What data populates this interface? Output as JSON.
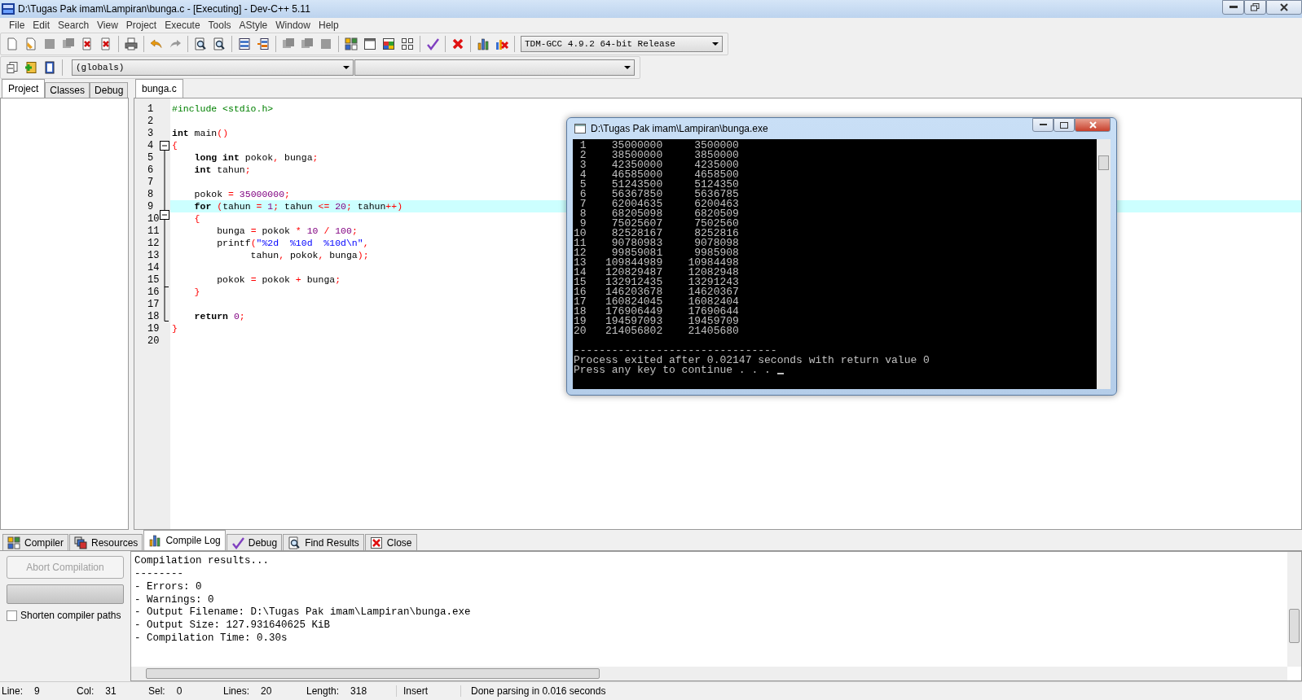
{
  "window": {
    "title": "D:\\Tugas Pak imam\\Lampiran\\bunga.c - [Executing] - Dev-C++ 5.11"
  },
  "menu": [
    "File",
    "Edit",
    "Search",
    "View",
    "Project",
    "Execute",
    "Tools",
    "AStyle",
    "Window",
    "Help"
  ],
  "toolbar": {
    "compiler": "TDM-GCC 4.9.2 64-bit Release",
    "scope": "(globals)"
  },
  "left_tabs": [
    {
      "label": "Project",
      "selected": true
    },
    {
      "label": "Classes",
      "selected": false
    },
    {
      "label": "Debug",
      "selected": false
    }
  ],
  "editor": {
    "tabs": [
      {
        "label": "bunga.c",
        "selected": true
      }
    ],
    "lines": [
      {
        "number": "1",
        "current": false,
        "tokens": [
          {
            "text": "#include <stdio.h>",
            "kind": "pp"
          }
        ]
      },
      {
        "number": "2",
        "current": false
      },
      {
        "number": "3",
        "current": false,
        "tokens": [
          {
            "text": "int",
            "kind": "kw"
          },
          {
            "text": " main",
            "kind": "id"
          },
          {
            "text": "()",
            "kind": "op"
          }
        ]
      },
      {
        "number": "4",
        "current": false,
        "tokens": [
          {
            "text": "{",
            "kind": "op"
          }
        ]
      },
      {
        "number": "5",
        "current": false,
        "tokens": [
          {
            "text": "    long int",
            "kind": "kw"
          },
          {
            "text": " pokok",
            "kind": "id"
          },
          {
            "text": ",",
            "kind": "op"
          },
          {
            "text": " bunga",
            "kind": "id"
          },
          {
            "text": ";",
            "kind": "op"
          }
        ]
      },
      {
        "number": "6",
        "current": false,
        "tokens": [
          {
            "text": "    int",
            "kind": "kw"
          },
          {
            "text": " tahun",
            "kind": "id"
          },
          {
            "text": ";",
            "kind": "op"
          }
        ]
      },
      {
        "number": "7",
        "current": false
      },
      {
        "number": "8",
        "current": false,
        "tokens": [
          {
            "text": "    pokok ",
            "kind": "id"
          },
          {
            "text": "= ",
            "kind": "op"
          },
          {
            "text": "35000000",
            "kind": "num"
          },
          {
            "text": ";",
            "kind": "op"
          }
        ]
      },
      {
        "number": "9",
        "current": true,
        "tokens": [
          {
            "text": "    for ",
            "kind": "kw"
          },
          {
            "text": "(",
            "kind": "op"
          },
          {
            "text": "tahun ",
            "kind": "id"
          },
          {
            "text": "= ",
            "kind": "op"
          },
          {
            "text": "1",
            "kind": "num"
          },
          {
            "text": "; ",
            "kind": "op"
          },
          {
            "text": "tahun ",
            "kind": "id"
          },
          {
            "text": "<= ",
            "kind": "op"
          },
          {
            "text": "20",
            "kind": "num"
          },
          {
            "text": "; ",
            "kind": "op"
          },
          {
            "text": "tahun",
            "kind": "id"
          },
          {
            "text": "++)",
            "kind": "op"
          }
        ]
      },
      {
        "number": "10",
        "current": false,
        "tokens": [
          {
            "text": "    {",
            "kind": "op"
          }
        ]
      },
      {
        "number": "11",
        "current": false,
        "tokens": [
          {
            "text": "        bunga ",
            "kind": "id"
          },
          {
            "text": "= ",
            "kind": "op"
          },
          {
            "text": "pokok ",
            "kind": "id"
          },
          {
            "text": "* ",
            "kind": "op"
          },
          {
            "text": "10 ",
            "kind": "num"
          },
          {
            "text": "/ ",
            "kind": "op"
          },
          {
            "text": "100",
            "kind": "num"
          },
          {
            "text": ";",
            "kind": "op"
          }
        ]
      },
      {
        "number": "12",
        "current": false,
        "tokens": [
          {
            "text": "        printf",
            "kind": "id"
          },
          {
            "text": "(",
            "kind": "op"
          },
          {
            "text": "\"%2d  %10d  %10d\\n\"",
            "kind": "str"
          },
          {
            "text": ",",
            "kind": "op"
          }
        ]
      },
      {
        "number": "13",
        "current": false,
        "tokens": [
          {
            "text": "              tahun",
            "kind": "id"
          },
          {
            "text": ",",
            "kind": "op"
          },
          {
            "text": " pokok",
            "kind": "id"
          },
          {
            "text": ",",
            "kind": "op"
          },
          {
            "text": " bunga",
            "kind": "id"
          },
          {
            "text": ");",
            "kind": "op"
          }
        ]
      },
      {
        "number": "14",
        "current": false
      },
      {
        "number": "15",
        "current": false,
        "tokens": [
          {
            "text": "        pokok ",
            "kind": "id"
          },
          {
            "text": "= ",
            "kind": "op"
          },
          {
            "text": "pokok ",
            "kind": "id"
          },
          {
            "text": "+ ",
            "kind": "op"
          },
          {
            "text": "bunga",
            "kind": "id"
          },
          {
            "text": ";",
            "kind": "op"
          }
        ]
      },
      {
        "number": "16",
        "current": false,
        "tokens": [
          {
            "text": "    }",
            "kind": "op"
          }
        ]
      },
      {
        "number": "17",
        "current": false
      },
      {
        "number": "18",
        "current": false,
        "tokens": [
          {
            "text": "    return ",
            "kind": "kw"
          },
          {
            "text": "0",
            "kind": "num"
          },
          {
            "text": ";",
            "kind": "op"
          }
        ]
      },
      {
        "number": "19",
        "current": false,
        "tokens": [
          {
            "text": "}",
            "kind": "op"
          }
        ]
      },
      {
        "number": "20",
        "current": false
      }
    ]
  },
  "console": {
    "title": "D:\\Tugas Pak imam\\Lampiran\\bunga.exe",
    "lines": [
      " 1    35000000     3500000",
      " 2    38500000     3850000",
      " 3    42350000     4235000",
      " 4    46585000     4658500",
      " 5    51243500     5124350",
      " 6    56367850     5636785",
      " 7    62004635     6200463",
      " 8    68205098     6820509",
      " 9    75025607     7502560",
      "10    82528167     8252816",
      "11    90780983     9078098",
      "12    99859081     9985908",
      "13   109844989    10984498",
      "14   120829487    12082948",
      "15   132912435    13291243",
      "16   146203678    14620367",
      "17   160824045    16082404",
      "18   176906449    17690644",
      "19   194597093    19459709",
      "20   214056802    21405680"
    ],
    "rule": "--------------------------------",
    "exit_message": "Process exited after 0.02147 seconds with return value 0",
    "prompt": "Press any key to continue . . . "
  },
  "bottom_tabs": [
    {
      "label": "Compiler",
      "selected": false
    },
    {
      "label": "Resources",
      "selected": false
    },
    {
      "label": "Compile Log",
      "selected": true
    },
    {
      "label": "Debug",
      "selected": false
    },
    {
      "label": "Find Results",
      "selected": false
    },
    {
      "label": "Close",
      "selected": false
    }
  ],
  "compile_panel": {
    "abort_button": {
      "label": "Abort Compilation",
      "disabled": true
    },
    "progress": {
      "level": 0
    },
    "shorten_paths": {
      "label": "Shorten compiler paths",
      "checked": false
    },
    "log": [
      "Compilation results...",
      "--------",
      "- Errors: 0",
      "- Warnings: 0",
      "- Output Filename: D:\\Tugas Pak imam\\Lampiran\\bunga.exe",
      "- Output Size: 127.931640625 KiB",
      "- Compilation Time: 0.30s"
    ]
  },
  "status_bar": [
    {
      "label": "Line:",
      "value": "9"
    },
    {
      "label": "Col:",
      "value": "31"
    },
    {
      "label": "Sel:",
      "value": "0"
    },
    {
      "label": "Lines:",
      "value": "20"
    },
    {
      "label": "Length:",
      "value": "318"
    },
    {
      "text": "Insert"
    },
    {
      "text": "Done parsing in 0.016 seconds"
    }
  ]
}
